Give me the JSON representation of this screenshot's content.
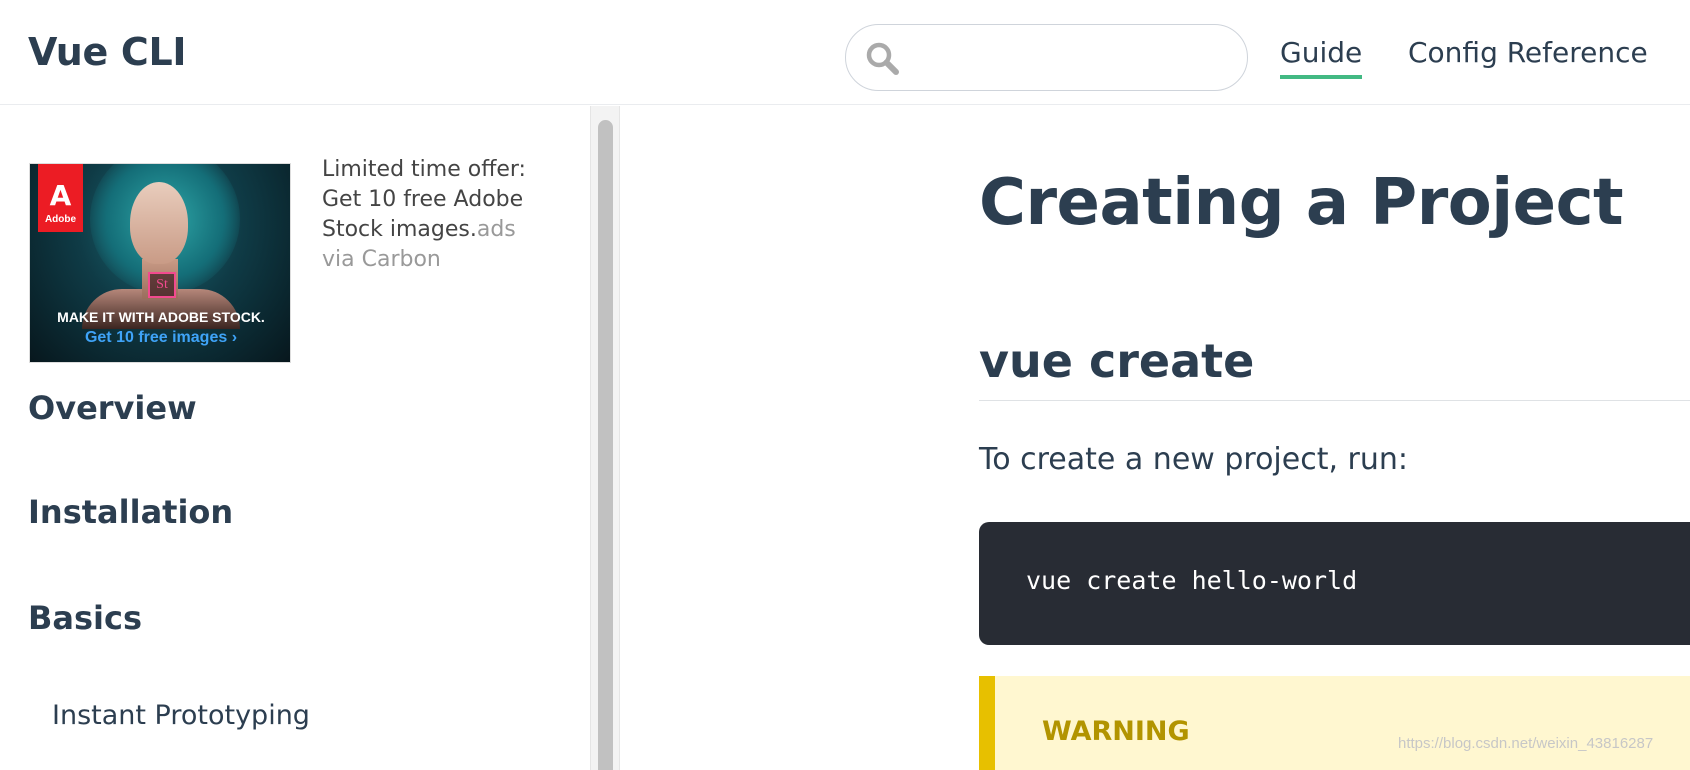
{
  "header": {
    "site_title": "Vue CLI",
    "search": {
      "placeholder": "",
      "value": ""
    },
    "nav": [
      {
        "label": "Guide",
        "active": true
      },
      {
        "label": "Config Reference",
        "active": false
      }
    ]
  },
  "sidebar": {
    "ad": {
      "logo_text": "Adobe",
      "badge": "St",
      "tagline": "MAKE IT WITH ADOBE STOCK.",
      "cta": "Get 10 free images ›",
      "text": "Limited time offer: Get 10 free Adobe Stock images.",
      "via": "ads via Carbon"
    },
    "headings": [
      "Overview",
      "Installation",
      "Basics"
    ],
    "sub_items": [
      "Instant Prototyping"
    ]
  },
  "main": {
    "page_title": "Creating a Project",
    "section_heading": "vue create",
    "paragraph": "To create a new project, run:",
    "code": "vue create hello-world",
    "warning_title": "WARNING"
  },
  "watermark": "https://blog.csdn.net/weixin_43816287",
  "colors": {
    "accent": "#42b983",
    "text": "#2c3e50",
    "code_bg": "#282c34",
    "warning_bg": "#fff7d0",
    "warning_border": "#e7c000",
    "warning_text": "#b29400"
  },
  "icons": {
    "search": "search-icon",
    "brand": "adobe-logo-icon"
  }
}
